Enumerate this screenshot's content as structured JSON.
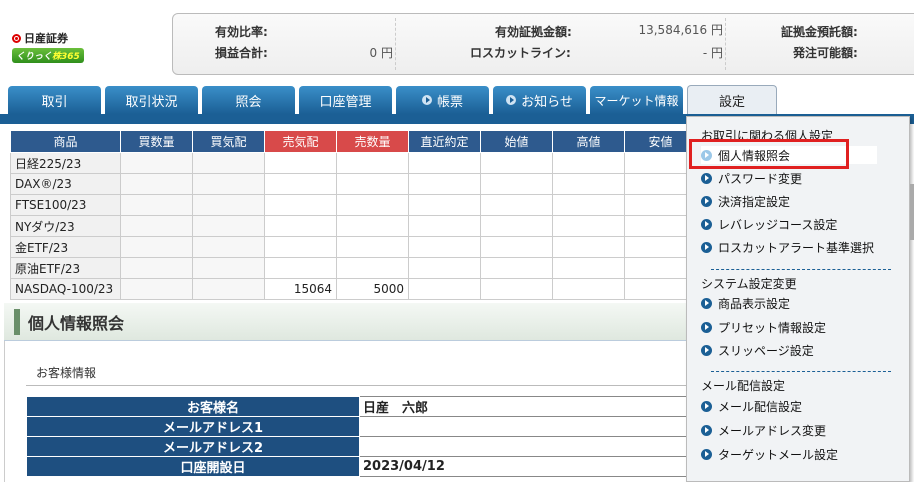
{
  "logo": {
    "brand": "日産証券",
    "sub_pre": "くりっく",
    "sub_main": "株365"
  },
  "summary": {
    "effective_ratio_label": "有効比率:",
    "effective_ratio_value": "",
    "pnl_label": "損益合計:",
    "pnl_value": "0 円",
    "effective_margin_label": "有効証拠金額:",
    "effective_margin_value": "13,584,616 円",
    "losscut_label": "ロスカットライン:",
    "losscut_value": "- 円",
    "margin_deposit_label": "証拠金預託額:",
    "orderable_label": "発注可能額:"
  },
  "tabs": [
    {
      "label": "取引",
      "icon": ""
    },
    {
      "label": "取引状況",
      "icon": ""
    },
    {
      "label": "照会",
      "icon": ""
    },
    {
      "label": "口座管理",
      "icon": ""
    },
    {
      "label": "帳票",
      "icon": "bullet"
    },
    {
      "label": "お知らせ",
      "icon": "bullet"
    },
    {
      "label": "マーケット情報",
      "icon": ""
    },
    {
      "label": "設定",
      "icon": ""
    }
  ],
  "quotes": {
    "headers": [
      "商品",
      "買数量",
      "買気配",
      "売気配",
      "売数量",
      "直近約定",
      "始値",
      "高値",
      "安値"
    ],
    "rows": [
      {
        "name": "日経225/23",
        "cells": [
          "",
          "",
          "",
          "",
          "",
          "",
          "",
          ""
        ]
      },
      {
        "name": "DAX®/23",
        "cells": [
          "",
          "",
          "",
          "",
          "",
          "",
          "",
          ""
        ]
      },
      {
        "name": "FTSE100/23",
        "cells": [
          "",
          "",
          "",
          "",
          "",
          "",
          "",
          ""
        ]
      },
      {
        "name": "NYダウ/23",
        "cells": [
          "",
          "",
          "",
          "",
          "",
          "",
          "",
          ""
        ]
      },
      {
        "name": "金ETF/23",
        "cells": [
          "",
          "",
          "",
          "",
          "",
          "",
          "",
          ""
        ]
      },
      {
        "name": "原油ETF/23",
        "cells": [
          "",
          "",
          "",
          "",
          "",
          "",
          "",
          ""
        ]
      },
      {
        "name": "NASDAQ-100/23",
        "cells": [
          "",
          "",
          "15064",
          "5000",
          "",
          "",
          "",
          ""
        ]
      }
    ]
  },
  "panel": {
    "title": "個人情報照会",
    "section_label": "お客様情報",
    "rows": [
      {
        "label": "お客様名",
        "value": "日産　六郎"
      },
      {
        "label": "メールアドレス1",
        "value": ""
      },
      {
        "label": "メールアドレス2",
        "value": ""
      },
      {
        "label": "口座開設日",
        "value": "2023/04/12"
      }
    ]
  },
  "settings_menu": {
    "section1": "お取引に関わる個人設定",
    "items1": [
      "個人情報照会",
      "パスワード変更",
      "決済指定設定",
      "レバレッジコース設定",
      "ロスカットアラート基準選択"
    ],
    "section2": "システム設定変更",
    "items2": [
      "商品表示設定",
      "プリセット情報設定",
      "スリッページ設定"
    ],
    "section3": "メール配信設定",
    "items3": [
      "メール配信設定",
      "メールアドレス変更",
      "ターゲットメール設定"
    ]
  }
}
